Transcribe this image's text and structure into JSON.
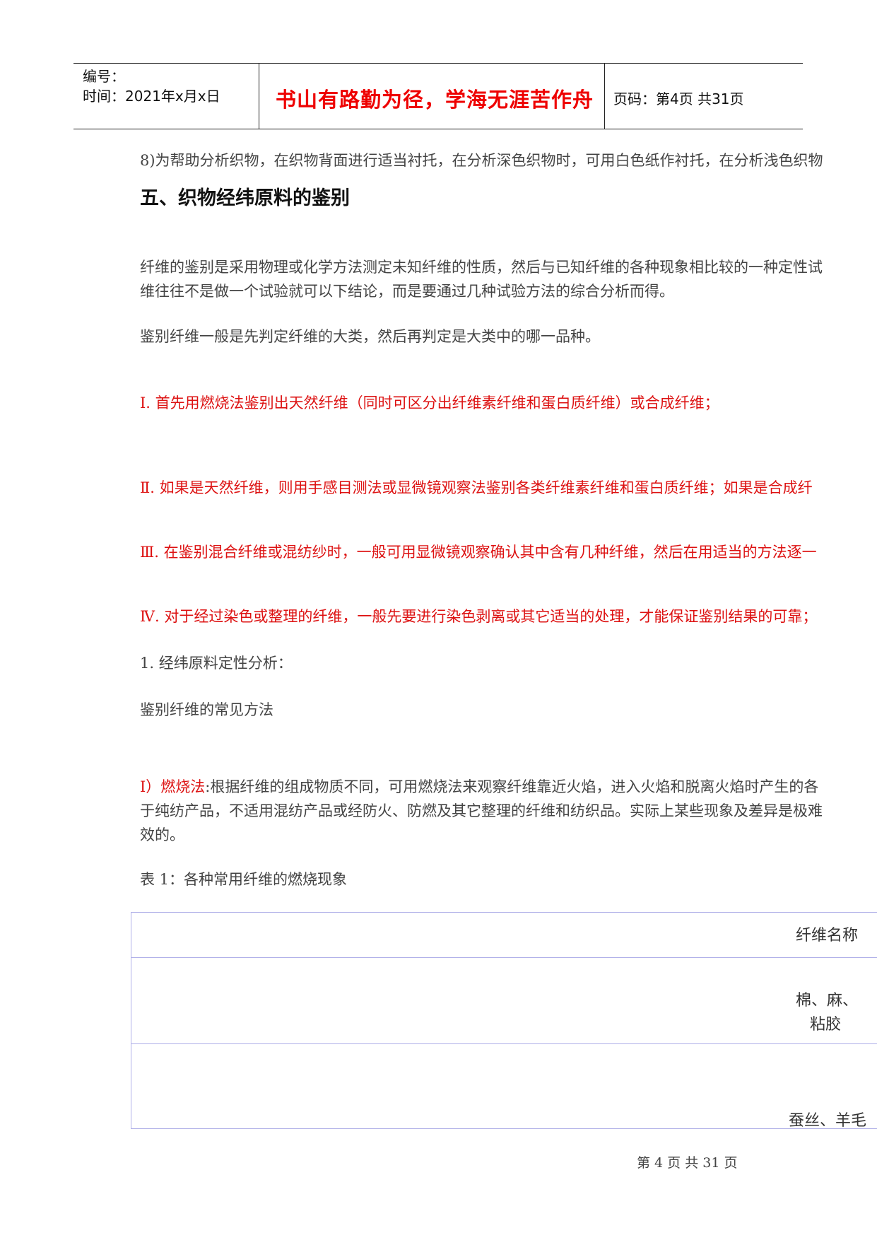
{
  "header": {
    "number_label": "编号：",
    "time_label": "时间：2021年x月x日",
    "motto": "书山有路勤为径，学海无涯苦作舟",
    "page_info": "页码：第4页  共31页"
  },
  "content": {
    "line_8": "8)为帮助分析织物，在织物背面进行适当衬托，在分析深色织物时，可用白色纸作衬托，在分析浅色织物",
    "section_heading": "五、织物经纬原料的鉴别",
    "para1_line1": "纤维的鉴别是采用物理或化学方法测定未知纤维的性质，然后与已知纤维的各种现象相比较的一种定性试",
    "para1_line2": "维往往不是做一个试验就可以下结论，而是要通过几种试验方法的综合分析而得。",
    "para2": "鉴别纤维一般是先判定纤维的大类，然后再判定是大类中的哪一品种。",
    "step1": "Ⅰ. 首先用燃烧法鉴别出天然纤维（同时可区分出纤维素纤维和蛋白质纤维）或合成纤维；",
    "step2": "Ⅱ. 如果是天然纤维，则用手感目测法或显微镜观察法鉴别各类纤维素纤维和蛋白质纤维；如果是合成纤",
    "step3": "Ⅲ. 在鉴别混合纤维或混纺纱时，一般可用显微镜观察确认其中含有几种纤维，然后在用适当的方法逐一",
    "step4": "Ⅳ. 对于经过染色或整理的纤维，一般先要进行染色剥离或其它适当的处理，才能保证鉴别结果的可靠；",
    "sub1": "1. 经纬原料定性分析：",
    "methods": "鉴别纤维的常见方法",
    "burn_prefix": "I）燃烧法",
    "burn_line1": ":根据纤维的组成物质不同，可用燃烧法来观察纤维靠近火焰，进入火焰和脱离火焰时产生的各",
    "burn_line2": "于纯纺产品，不适用混纺产品或经防火、防燃及其它整理的纤维和纺织品。实际上某些现象及差异是极难",
    "burn_line3": "效的。",
    "table_caption": "表 1：各种常用纤维的燃烧现象"
  },
  "table": {
    "header": "纤维名称",
    "row1_line1": "棉、麻、",
    "row1_line2": "粘胶",
    "row2": "蚕丝、羊毛"
  },
  "footer": {
    "page": "第 4 页 共 31 页"
  },
  "colors": {
    "motto": "#ee0000",
    "red_text": "#dd1111",
    "table_border": "#b0b0e8"
  }
}
